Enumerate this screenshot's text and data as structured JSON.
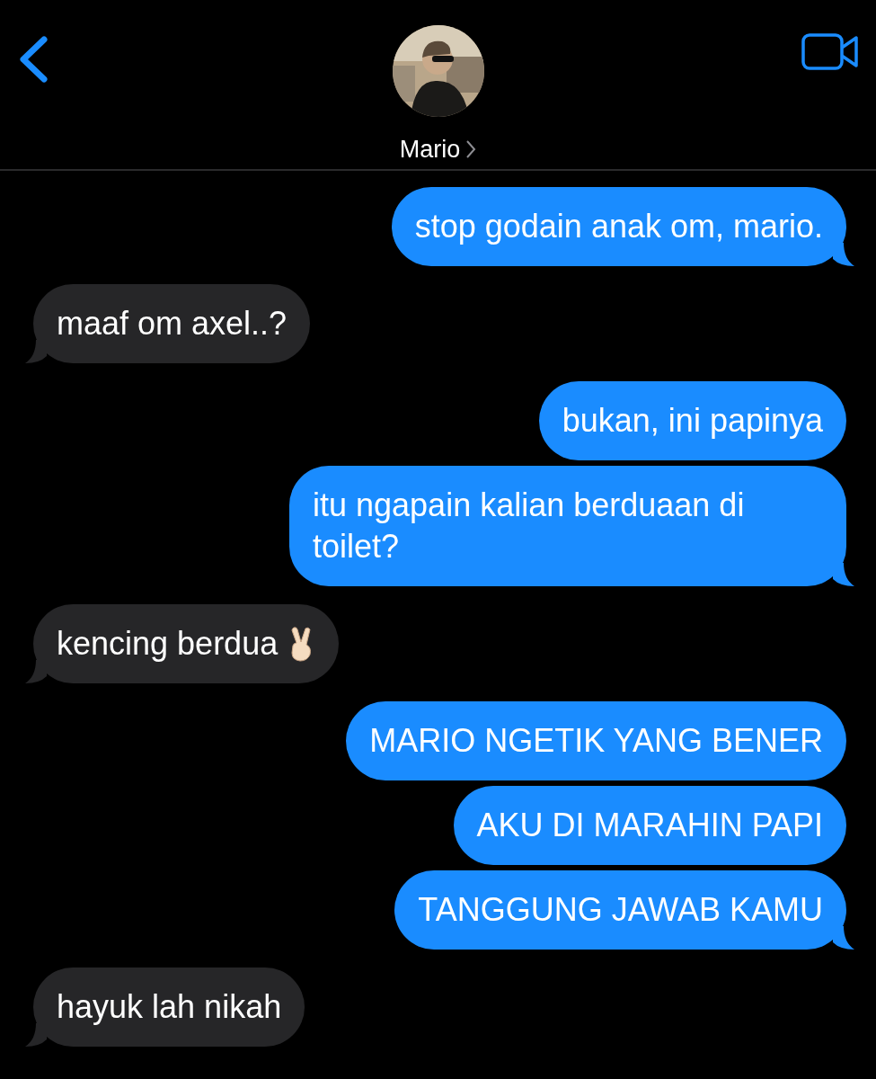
{
  "header": {
    "contact_name": "Mario"
  },
  "messages": [
    {
      "kind": "sent",
      "text": "stop godain anak om, mario.",
      "tail": true
    },
    {
      "kind": "received",
      "text": "maaf om axel..?",
      "tail": true
    },
    {
      "kind": "sent",
      "text": "bukan, ini papinya",
      "tail": false
    },
    {
      "kind": "sent",
      "text": "itu ngapain kalian berduaan di toilet?",
      "tail": true
    },
    {
      "kind": "peace",
      "text": "kencing berdua",
      "tail": true
    },
    {
      "kind": "sent",
      "text": "MARIO NGETIK YANG BENER",
      "tail": false
    },
    {
      "kind": "sent",
      "text": "AKU DI MARAHIN PAPI",
      "tail": false
    },
    {
      "kind": "sent",
      "text": "TANGGUNG JAWAB KAMU",
      "tail": true
    },
    {
      "kind": "received",
      "text": "hayuk lah nikah",
      "tail": true
    }
  ]
}
